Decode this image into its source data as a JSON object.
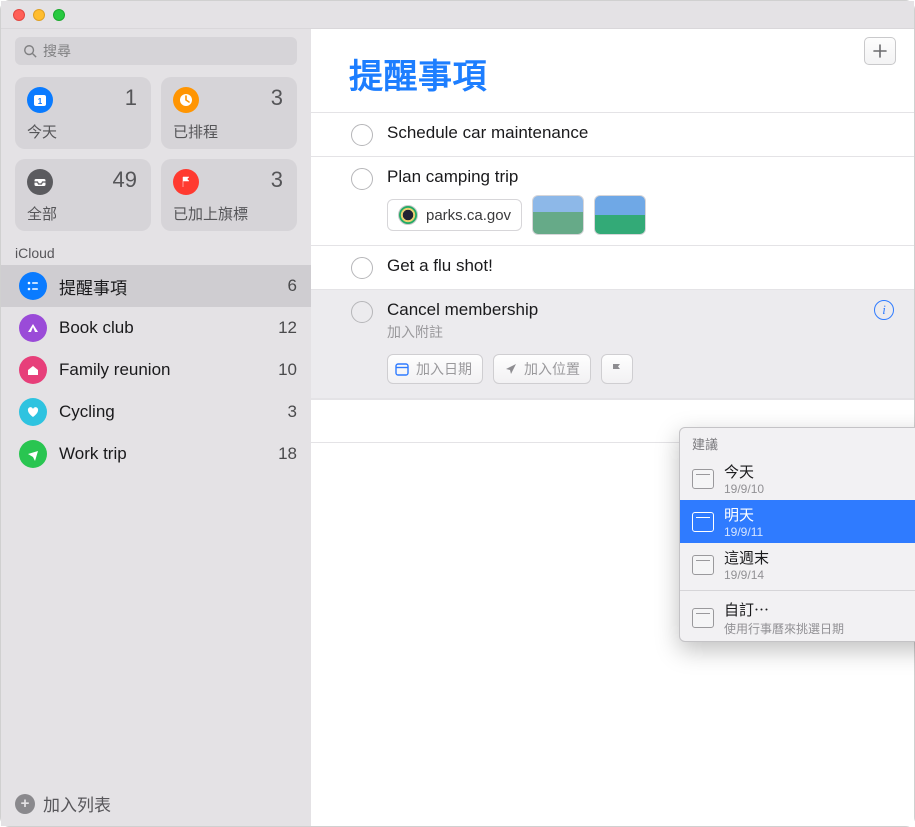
{
  "search": {
    "placeholder": "搜尋"
  },
  "smart_cards": {
    "today": {
      "label": "今天",
      "count": "1",
      "color": "#0a7bff"
    },
    "scheduled": {
      "label": "已排程",
      "count": "3",
      "color": "#ff9502"
    },
    "all": {
      "label": "全部",
      "count": "49",
      "color": "#5b5b5f"
    },
    "flagged": {
      "label": "已加上旗標",
      "count": "3",
      "color": "#ff3a30"
    }
  },
  "section": "iCloud",
  "lists": [
    {
      "name": "提醒事項",
      "count": "6",
      "color": "#0a7bff",
      "active": true
    },
    {
      "name": "Book club",
      "count": "12",
      "color": "#9a4bd8"
    },
    {
      "name": "Family reunion",
      "count": "10",
      "color": "#e73f7a"
    },
    {
      "name": "Cycling",
      "count": "3",
      "color": "#2ec3e0"
    },
    {
      "name": "Work trip",
      "count": "18",
      "color": "#29c551"
    }
  ],
  "add_list_label": "加入列表",
  "main_title": "提醒事項",
  "reminders": [
    {
      "title": "Schedule car maintenance"
    },
    {
      "title": "Plan camping trip",
      "link": "parks.ca.gov"
    },
    {
      "title": "Get a flu shot!"
    },
    {
      "title": "Cancel membership",
      "editing": true,
      "note_placeholder": "加入附註",
      "date_placeholder": "加入日期",
      "location_placeholder": "加入位置"
    }
  ],
  "popover": {
    "header": "建議",
    "items": [
      {
        "t1": "今天",
        "t2": "19/9/10"
      },
      {
        "t1": "明天",
        "t2": "19/9/11",
        "selected": true
      },
      {
        "t1": "這週末",
        "t2": "19/9/14"
      }
    ],
    "custom": {
      "t1": "自訂⋯",
      "t2": "使用行事曆來挑選日期"
    }
  }
}
